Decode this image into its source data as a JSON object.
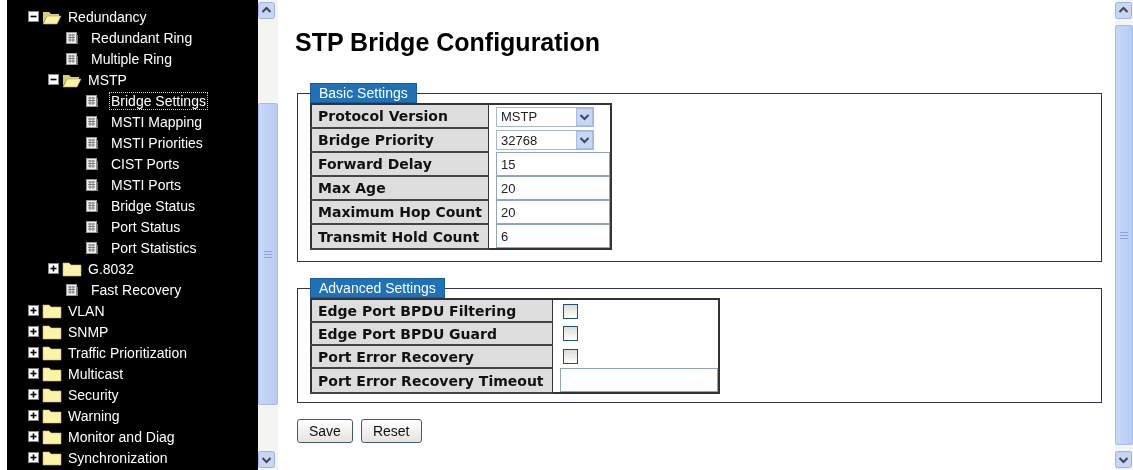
{
  "sidebar": {
    "tree": [
      {
        "kind": "folder",
        "label": "Redundancy",
        "expanded": true,
        "children": [
          {
            "kind": "page",
            "label": "Redundant Ring",
            "selected": false
          },
          {
            "kind": "page",
            "label": "Multiple Ring",
            "selected": false
          },
          {
            "kind": "folder",
            "label": "MSTP",
            "expanded": true,
            "children": [
              {
                "kind": "page",
                "label": "Bridge Settings",
                "selected": true
              },
              {
                "kind": "page",
                "label": "MSTI Mapping",
                "selected": false
              },
              {
                "kind": "page",
                "label": "MSTI Priorities",
                "selected": false
              },
              {
                "kind": "page",
                "label": "CIST Ports",
                "selected": false
              },
              {
                "kind": "page",
                "label": "MSTI Ports",
                "selected": false
              },
              {
                "kind": "page",
                "label": "Bridge Status",
                "selected": false
              },
              {
                "kind": "page",
                "label": "Port Status",
                "selected": false
              },
              {
                "kind": "page",
                "label": "Port Statistics",
                "selected": false
              }
            ]
          },
          {
            "kind": "folder",
            "label": "G.8032",
            "expanded": false
          },
          {
            "kind": "page",
            "label": "Fast Recovery",
            "selected": false
          }
        ]
      },
      {
        "kind": "folder",
        "label": "VLAN",
        "expanded": false
      },
      {
        "kind": "folder",
        "label": "SNMP",
        "expanded": false
      },
      {
        "kind": "folder",
        "label": "Traffic Prioritization",
        "expanded": false
      },
      {
        "kind": "folder",
        "label": "Multicast",
        "expanded": false
      },
      {
        "kind": "folder",
        "label": "Security",
        "expanded": false
      },
      {
        "kind": "folder",
        "label": "Warning",
        "expanded": false
      },
      {
        "kind": "folder",
        "label": "Monitor and Diag",
        "expanded": false
      },
      {
        "kind": "folder",
        "label": "Synchronization",
        "expanded": false
      }
    ]
  },
  "page": {
    "title": "STP Bridge Configuration",
    "sections": [
      {
        "legend": "Basic Settings",
        "rows": [
          {
            "label": "Protocol Version",
            "kind": "select",
            "value": "MSTP"
          },
          {
            "label": "Bridge Priority",
            "kind": "select",
            "value": "32768"
          },
          {
            "label": "Forward Delay",
            "kind": "text",
            "value": "15"
          },
          {
            "label": "Max Age",
            "kind": "text",
            "value": "20"
          },
          {
            "label": "Maximum Hop Count",
            "kind": "text",
            "value": "20"
          },
          {
            "label": "Transmit Hold Count",
            "kind": "text",
            "value": "6"
          }
        ]
      },
      {
        "legend": "Advanced Settings",
        "rows": [
          {
            "label": "Edge Port BPDU Filtering",
            "kind": "checkbox",
            "checked": false
          },
          {
            "label": "Edge Port BPDU Guard",
            "kind": "checkbox",
            "checked": false
          },
          {
            "label": "Port Error Recovery",
            "kind": "checkbox",
            "checked": false
          },
          {
            "label": "Port Error Recovery Timeout",
            "kind": "text"
          }
        ]
      }
    ],
    "buttons": [
      "Save",
      "Reset"
    ]
  }
}
